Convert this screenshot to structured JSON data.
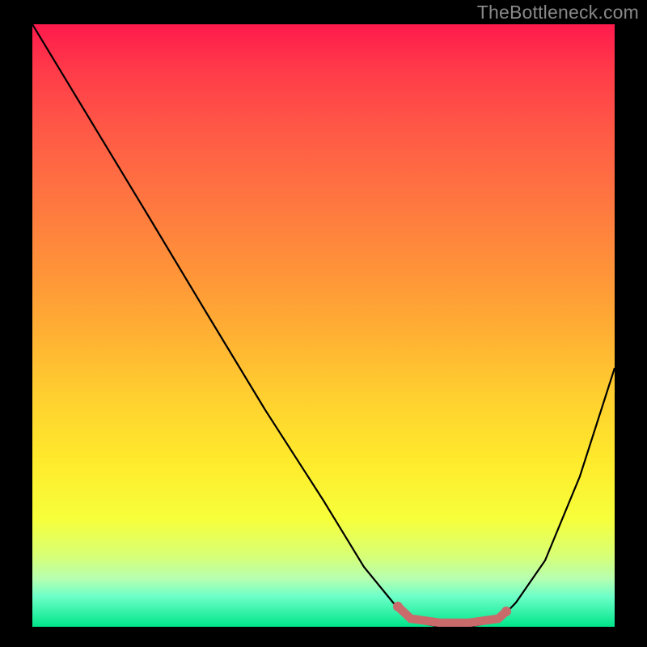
{
  "watermark": "TheBottleneck.com",
  "chart_data": {
    "type": "line",
    "title": "",
    "xlabel": "",
    "ylabel": "",
    "xlim": [
      0,
      100
    ],
    "ylim": [
      0,
      100
    ],
    "series": [
      {
        "name": "bottleneck-curve",
        "x": [
          0,
          10,
          20,
          30,
          40,
          50,
          57,
          62,
          65,
          70,
          75,
          80,
          83,
          88,
          94,
          100
        ],
        "y": [
          100,
          84,
          68,
          52,
          36,
          21,
          10,
          4,
          1,
          0,
          0,
          1,
          4,
          11,
          25,
          43
        ]
      }
    ],
    "highlight_range_x": [
      63,
      81
    ],
    "colors": {
      "curve": "#000000",
      "highlight": "#c96b6b",
      "gradient_top": "#ff1a4c",
      "gradient_bottom": "#00e58a"
    }
  }
}
